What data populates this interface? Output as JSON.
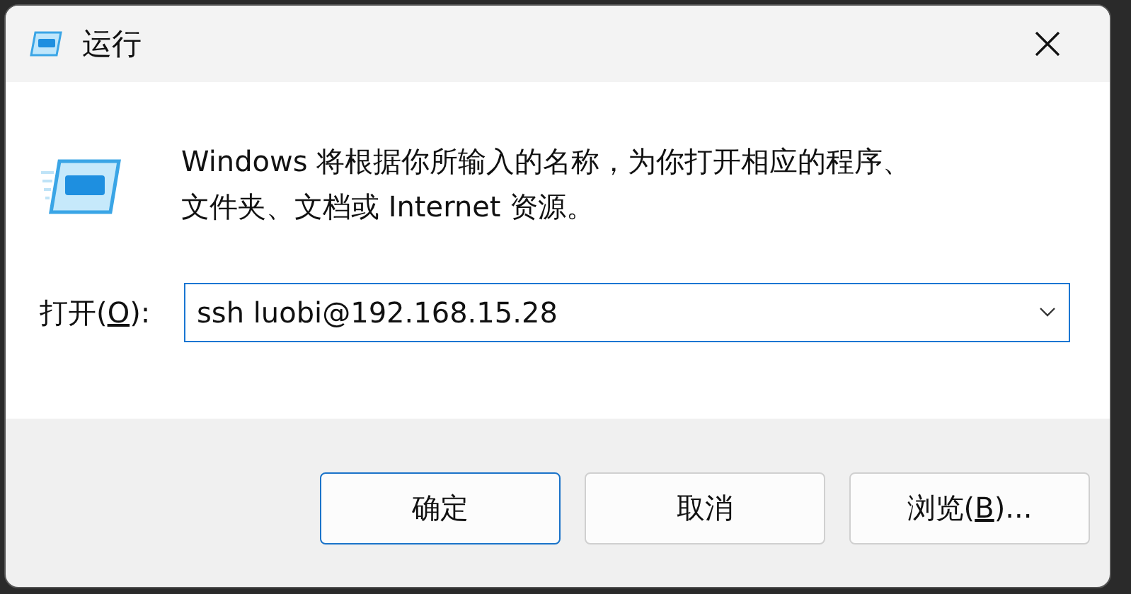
{
  "window": {
    "title": "运行"
  },
  "description": "Windows 将根据你所输入的名称，为你打开相应的程序、文件夹、文档或 Internet 资源。",
  "open_field": {
    "label": {
      "before": "打开(",
      "access_key": "O",
      "after": "):"
    },
    "value": "ssh luobi@192.168.15.28"
  },
  "buttons": [
    {
      "label": {
        "before": "确定"
      },
      "default": true
    },
    {
      "label": {
        "before": "取消"
      },
      "default": false
    },
    {
      "label": {
        "before": "浏览(",
        "access_key": "B",
        "after": ")..."
      },
      "default": false
    }
  ]
}
